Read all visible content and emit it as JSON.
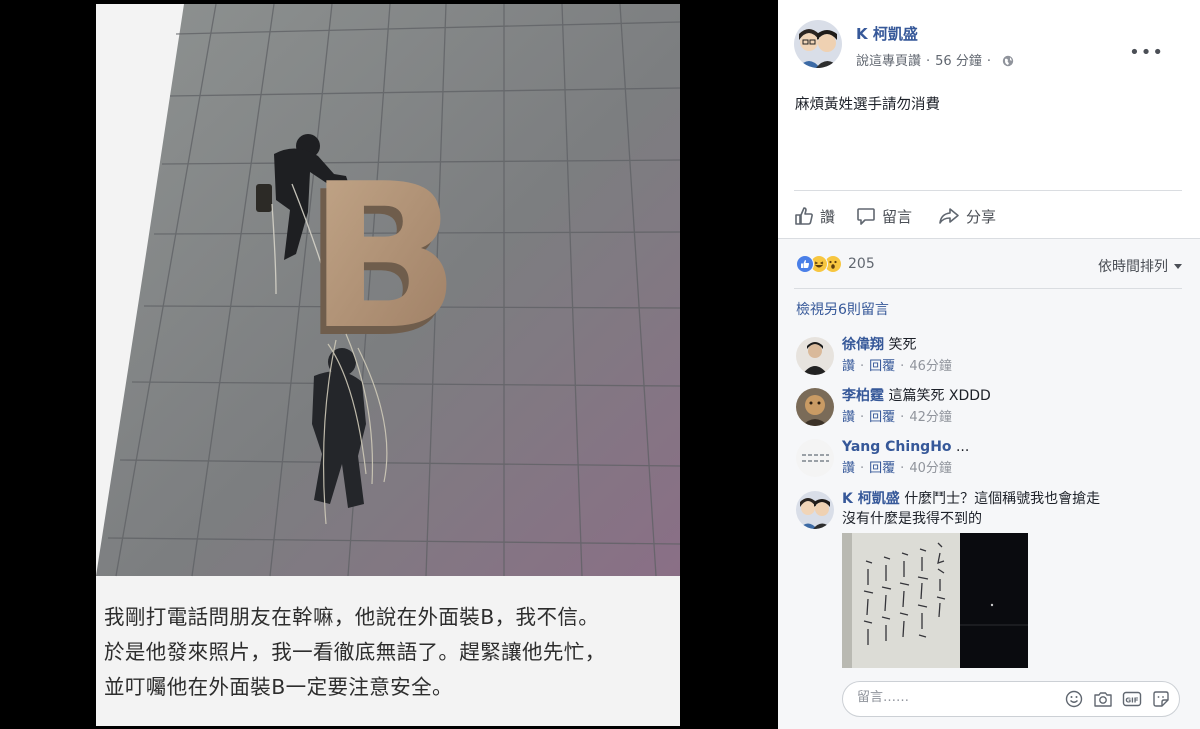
{
  "post": {
    "author": "K 柯凱盛",
    "via": "說這專頁讚",
    "time": "56 分鐘",
    "text": "麻煩黃姓選手請勿消費",
    "image_caption": [
      "我剛打電話問朋友在幹嘛，他說在外面裝B，我不信。",
      "於是他發來照片，我一看徹底無語了。趕緊讓他先忙，",
      "並叮囑他在外面裝B一定要注意安全。"
    ],
    "sign_letter": "B"
  },
  "actions": {
    "like": "讚",
    "comment": "留言",
    "share": "分享"
  },
  "reactions": {
    "count": "205",
    "sort_label": "依時間排列"
  },
  "comments_header": {
    "view_more": "檢視另6則留言"
  },
  "comments": [
    {
      "name": "徐偉翔",
      "text": "笑死",
      "like": "讚",
      "reply": "回覆",
      "time": "46分鐘"
    },
    {
      "name": "李柏霆",
      "text": "這篇笑死 XDDD",
      "like": "讚",
      "reply": "回覆",
      "time": "42分鐘"
    },
    {
      "name": "Yang ChingHo",
      "text": "...",
      "like": "讚",
      "reply": "回覆",
      "time": "40分鐘"
    },
    {
      "name": "K 柯凱盛",
      "text": "什麼鬥士？這個稱號我也會搶走",
      "text2": "沒有什麼是我得不到的"
    }
  ],
  "composer": {
    "placeholder": "留言……"
  },
  "colors": {
    "link": "#365899",
    "muted": "#90949c",
    "panel_bg": "#f6f7f9",
    "like_blue": "#4a7fe8",
    "emoji_yellow": "#f7c640"
  }
}
